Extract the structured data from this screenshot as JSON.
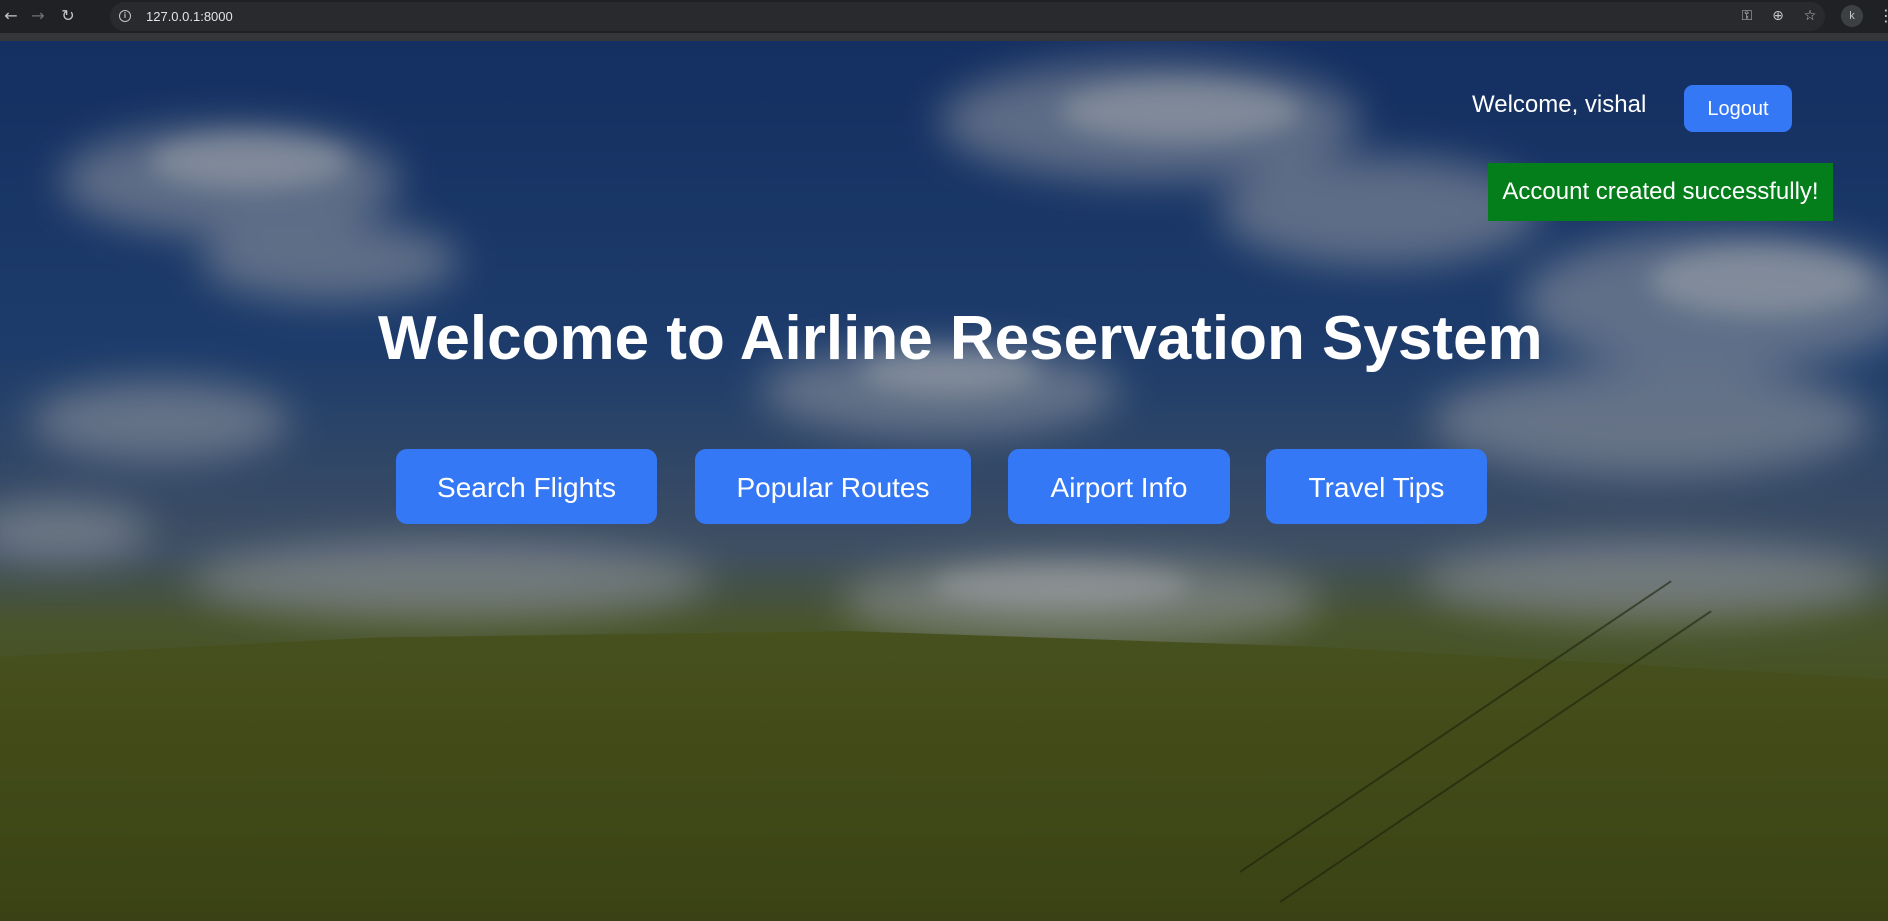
{
  "browser": {
    "url": "127.0.0.1:8000",
    "profile_initial": "k"
  },
  "header": {
    "welcome_text": "Welcome, vishal",
    "logout_label": "Logout"
  },
  "alert": {
    "message": "Account created successfully!",
    "color": "#047d1b"
  },
  "hero": {
    "title": "Welcome to Airline Reservation System"
  },
  "nav_buttons": [
    {
      "label": "Search Flights"
    },
    {
      "label": "Popular Routes"
    },
    {
      "label": "Airport Info"
    },
    {
      "label": "Travel Tips"
    }
  ],
  "colors": {
    "accent": "#3478f6"
  }
}
